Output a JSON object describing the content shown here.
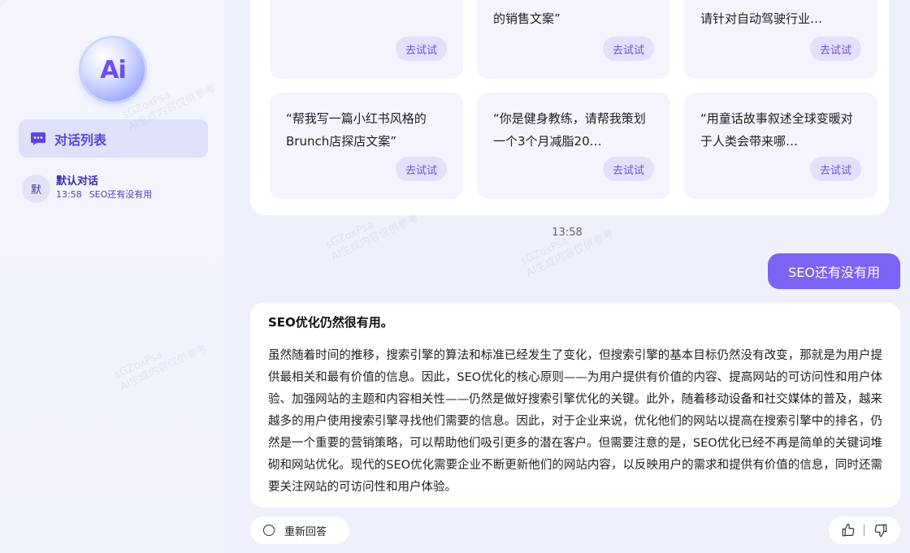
{
  "sidebar": {
    "logo_text": "Ai",
    "conv_list_label": "对话列表",
    "conversations": [
      {
        "avatar": "默",
        "title": "默认对话",
        "time": "13:58",
        "preview": "SEO还有没有用"
      }
    ]
  },
  "prompts": [
    {
      "text": "",
      "try_label": "去试试"
    },
    {
      "text": "的销售文案”",
      "try_label": "去试试"
    },
    {
      "text": "请针对自动驾驶行业…",
      "try_label": "去试试"
    },
    {
      "text": "“帮我写一篇小红书风格的Brunch店探店文案”",
      "try_label": "去试试"
    },
    {
      "text": "“你是健身教练，请帮我策划一个3个月减脂20…",
      "try_label": "去试试"
    },
    {
      "text": "“用童话故事叙述全球变暖对于人类会带来哪…",
      "try_label": "去试试"
    }
  ],
  "chat": {
    "timestamp": "13:58",
    "user_message": "SEO还有没有用",
    "answer_heading": "SEO优化仍然很有用。",
    "answer_body": "虽然随着时间的推移，搜索引擎的算法和标准已经发生了变化，但搜索引擎的基本目标仍然没有改变，那就是为用户提供最相关和最有价值的信息。因此，SEO优化的核心原则——为用户提供有价值的内容、提高网站的可访问性和用户体验、加强网站的主题和内容相关性——仍然是做好搜索引擎优化的关键。此外，随着移动设备和社交媒体的普及，越来越多的用户使用搜索引擎寻找他们需要的信息。因此，对于企业来说，优化他们的网站以提高在搜索引擎中的排名，仍然是一个重要的营销策略，可以帮助他们吸引更多的潜在客户。但需要注意的是，SEO优化已经不再是简单的关键词堆砌和网站优化。现代的SEO优化需要企业不断更新他们的网站内容，以反映用户的需求和提供有价值的信息，同时还需要关注网站的可访问性和用户体验。",
    "regenerate_label": "重新回答"
  },
  "watermark": {
    "line1": "sGZoxPsa",
    "line2": "AI生成内容仅供参考"
  },
  "colors": {
    "accent": "#7c62f5",
    "accent_dark": "#5b45e0",
    "try_bg": "#e4e0fb",
    "card_bg": "#f3f4fd"
  }
}
